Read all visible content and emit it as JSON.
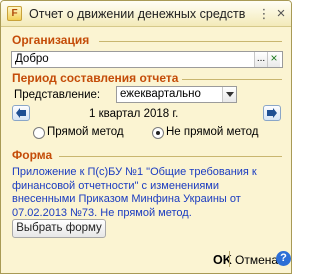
{
  "window": {
    "title": "Отчет о движении денежных средств",
    "icon_text": "F",
    "buttons": {
      "menu": "⋮",
      "close": "×"
    }
  },
  "organization": {
    "section_title": "Организация",
    "value": "Добро",
    "select_button": "...",
    "clear_button": "×"
  },
  "period": {
    "section_title": "Период составления отчета",
    "representation_label": "Представление:",
    "representation_value": "ежеквартально",
    "period_text": "1 квартал 2018 г.",
    "method_direct": "Прямой метод",
    "method_indirect": "Не прямой метод",
    "selected_method": "indirect"
  },
  "form": {
    "section_title": "Форма",
    "description_lines": [
      "Приложение к П(с)БУ №1 \"Общие требования к",
      "финансовой отчетности\" с изменениями",
      "внесенными Приказом Минфина Украины от",
      "07.02.2013 №73. Не прямой метод."
    ],
    "choose_button": "Выбрать форму"
  },
  "footer": {
    "ok": "OK",
    "cancel": "Отмена",
    "help": "?"
  }
}
